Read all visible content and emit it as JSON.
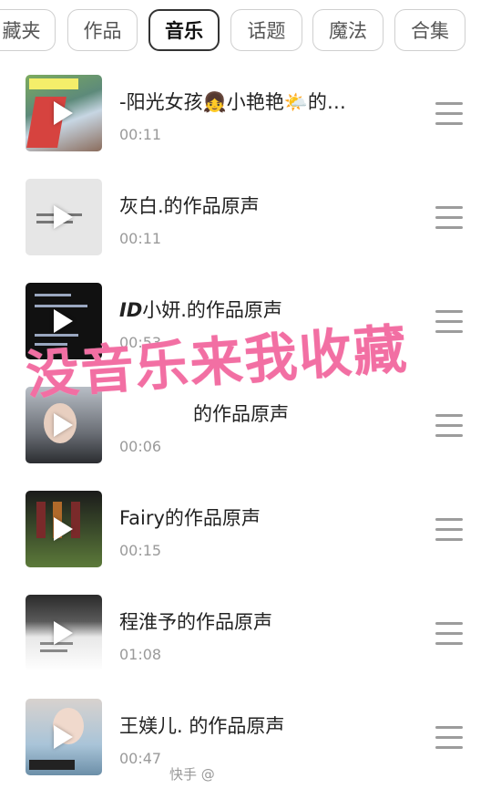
{
  "tabs": [
    {
      "label": "藏夹",
      "active": false
    },
    {
      "label": "作品",
      "active": false
    },
    {
      "label": "音乐",
      "active": true
    },
    {
      "label": "话题",
      "active": false
    },
    {
      "label": "魔法",
      "active": false
    },
    {
      "label": "合集",
      "active": false
    }
  ],
  "items": [
    {
      "title": "-阳光女孩👧小艳艳🌤️的…",
      "duration": "00:11"
    },
    {
      "title": "灰白.的作品原声",
      "duration": "00:11"
    },
    {
      "title_bold": "ID",
      "title": "小妍.的作品原声",
      "duration": "00:53"
    },
    {
      "title": "的作品原声",
      "duration": "00:06"
    },
    {
      "title": "Fairy的作品原声",
      "duration": "00:15"
    },
    {
      "title": "程淮予的作品原声",
      "duration": "01:08"
    },
    {
      "title": "王媄儿. 的作品原声",
      "duration": "00:47"
    }
  ],
  "overlay_text": "没音乐来我收藏",
  "watermark": "快手 @",
  "icons": {
    "play": "play-icon",
    "menu": "drag-handle-icon"
  },
  "colors": {
    "overlay": "#f26fa3",
    "active_tab_border": "#333333"
  }
}
